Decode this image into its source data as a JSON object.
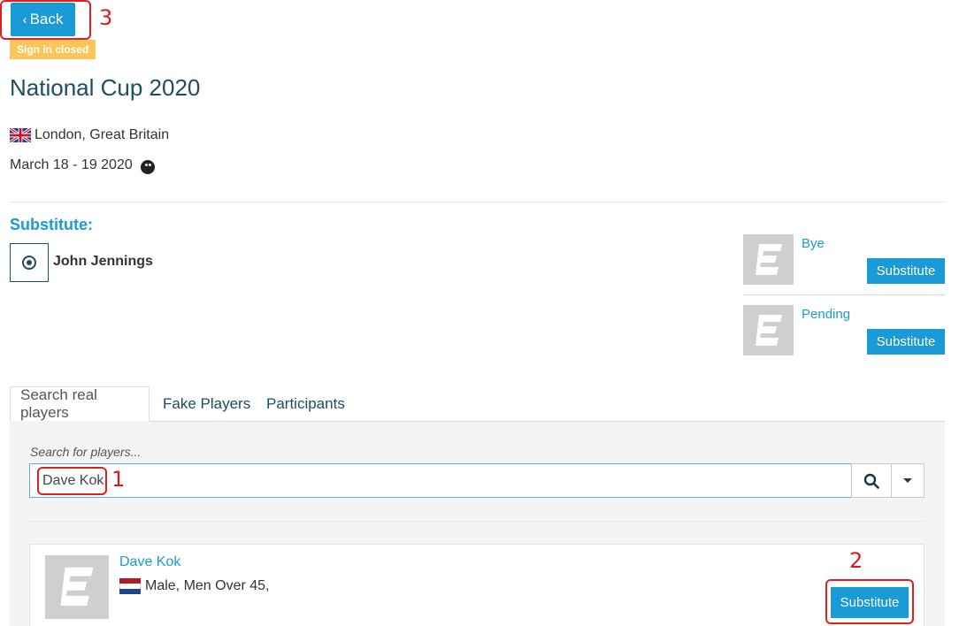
{
  "header": {
    "back_label": "Back",
    "signin_badge": "Sign in closed",
    "title": "National Cup 2020",
    "location": "London, Great Britain",
    "dates": "March 18 - 19 2020"
  },
  "substitute": {
    "heading": "Substitute:",
    "player_name": "John Jennings",
    "slots": [
      {
        "label": "Bye",
        "button": "Substitute"
      },
      {
        "label": "Pending",
        "button": "Substitute"
      }
    ]
  },
  "tabs": [
    {
      "label": "Search real players",
      "active": true
    },
    {
      "label": "Fake Players",
      "active": false
    },
    {
      "label": "Participants",
      "active": false
    }
  ],
  "search": {
    "label": "Search for players...",
    "value": "Dave Kok"
  },
  "results": [
    {
      "name": "Dave Kok",
      "info": "Male, Men Over 45,",
      "button": "Substitute"
    }
  ],
  "callouts": [
    "1",
    "2",
    "3"
  ],
  "colors": {
    "accent": "#1a9bd7",
    "title": "#1d4d63",
    "badge": "#fbc55a",
    "callout": "#e02020"
  },
  "icons": [
    "chevron-left-icon",
    "uk-flag-icon",
    "ball-icon",
    "target-icon",
    "search-icon",
    "caret-down-icon",
    "nl-flag-icon",
    "player-avatar-icon"
  ]
}
